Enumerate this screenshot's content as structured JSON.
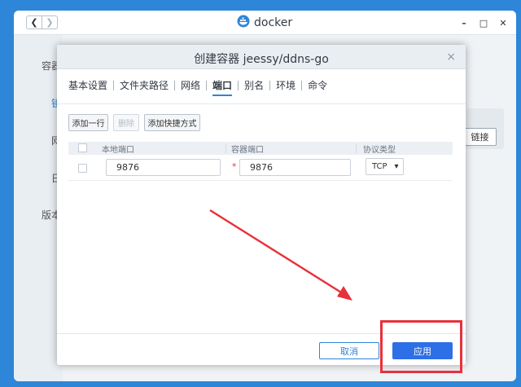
{
  "app": {
    "title": "docker",
    "nav_back": "❮",
    "nav_forward": "❯",
    "controls": {
      "min": "–",
      "max": "□",
      "close": "✕"
    },
    "brand_color": "#2d86d8"
  },
  "background": {
    "sidebar_items": [
      "容器",
      "镜",
      "网",
      "日",
      "版本"
    ],
    "link_button": "链接"
  },
  "dialog": {
    "title": "创建容器 jeessy/ddns-go",
    "close": "×",
    "tabs": [
      {
        "label": "基本设置",
        "active": false
      },
      {
        "label": "文件夹路径",
        "active": false
      },
      {
        "label": "网络",
        "active": false
      },
      {
        "label": "端口",
        "active": true
      },
      {
        "label": "别名",
        "active": false
      },
      {
        "label": "环境",
        "active": false
      },
      {
        "label": "命令",
        "active": false
      }
    ],
    "toolbar": {
      "add_row": "添加一行",
      "delete": "删除",
      "add_shortcut": "添加快捷方式"
    },
    "table": {
      "columns": [
        "本地端口",
        "容器端口",
        "协议类型"
      ],
      "rows": [
        {
          "local_port": "9876",
          "required_mark": "*",
          "container_port": "9876",
          "protocol": "TCP",
          "dropdown_icon": "▾"
        }
      ]
    },
    "footer": {
      "cancel": "取消",
      "apply": "应用"
    }
  },
  "annotations": {
    "color": "#e8313a"
  }
}
